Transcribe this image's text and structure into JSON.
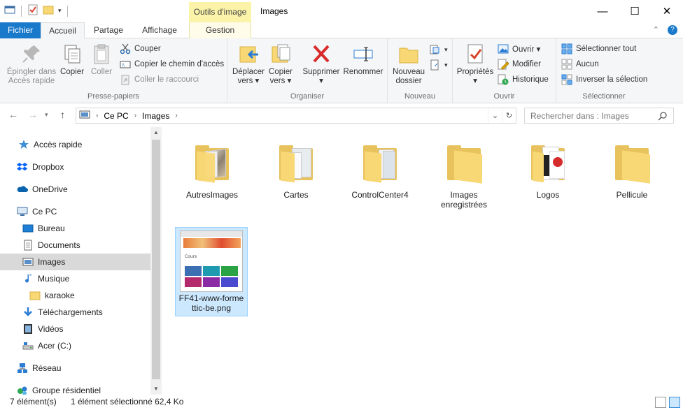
{
  "window": {
    "context_tab_header": "Outils d'image",
    "title": "Images",
    "controls": [
      "—",
      "☐",
      "✕"
    ]
  },
  "tabs": {
    "file": "Fichier",
    "home": "Accueil",
    "share": "Partage",
    "view": "Affichage",
    "manage": "Gestion"
  },
  "ribbon": {
    "clipboard": {
      "label": "Presse-papiers",
      "pin": [
        "Épingler dans",
        "Accès rapide"
      ],
      "copy": "Copier",
      "paste": "Coller",
      "cut": "Couper",
      "copy_path": "Copier le chemin d'accès",
      "paste_shortcut": "Coller le raccourci"
    },
    "organize": {
      "label": "Organiser",
      "move_to": [
        "Déplacer",
        "vers ▾"
      ],
      "copy_to": [
        "Copier",
        "vers ▾"
      ],
      "delete": [
        "Supprimer",
        "▾"
      ],
      "rename": "Renommer"
    },
    "new": {
      "label": "Nouveau",
      "new_folder": [
        "Nouveau",
        "dossier"
      ]
    },
    "open": {
      "label": "Ouvrir",
      "properties": [
        "Propriétés",
        "▾"
      ],
      "open": "Ouvrir ▾",
      "edit": "Modifier",
      "history": "Historique"
    },
    "select": {
      "label": "Sélectionner",
      "select_all": "Sélectionner tout",
      "select_none": "Aucun",
      "invert": "Inverser la sélection"
    }
  },
  "address": {
    "crumbs": [
      "Ce PC",
      "Images"
    ],
    "search_placeholder": "Rechercher dans : Images"
  },
  "navpane": {
    "items": [
      {
        "label": "Accès rapide",
        "icon": "star-icon"
      },
      {
        "label": "Dropbox",
        "icon": "dropbox-icon"
      },
      {
        "label": "OneDrive",
        "icon": "cloud-icon"
      },
      {
        "label": "Ce PC",
        "icon": "computer-icon"
      },
      {
        "label": "Bureau",
        "icon": "desktop-icon"
      },
      {
        "label": "Documents",
        "icon": "documents-icon"
      },
      {
        "label": "Images",
        "icon": "pictures-icon"
      },
      {
        "label": "Musique",
        "icon": "music-icon"
      },
      {
        "label": "karaoke",
        "icon": "folder-icon"
      },
      {
        "label": "Téléchargements",
        "icon": "download-icon"
      },
      {
        "label": "Vidéos",
        "icon": "video-icon"
      },
      {
        "label": "Acer (C:)",
        "icon": "drive-icon"
      },
      {
        "label": "Réseau",
        "icon": "network-icon"
      },
      {
        "label": "Groupe résidentiel",
        "icon": "homegroup-icon"
      }
    ],
    "selected": "Images"
  },
  "files": [
    {
      "name": "AutresImages",
      "type": "folder"
    },
    {
      "name": "Cartes",
      "type": "folder"
    },
    {
      "name": "ControlCenter4",
      "type": "folder"
    },
    {
      "name": "Images enregistrées",
      "type": "folder"
    },
    {
      "name": "Logos",
      "type": "folder"
    },
    {
      "name": "Pellicule",
      "type": "folder"
    },
    {
      "name": "FF41-www-formettic-be.png",
      "name_display": [
        "FF41-www-forme",
        "ttic-be.png"
      ],
      "type": "image",
      "selected": true
    }
  ],
  "thumbnail": {
    "site_heading": "Cours"
  },
  "status": {
    "count": "7 élément(s)",
    "selection": "1 élément sélectionné  62,4 Ko"
  },
  "colors": {
    "accent": "#1979ca",
    "context_tab": "#fbf3a8",
    "selection": "#cce8ff",
    "folder": "#f8d775"
  }
}
